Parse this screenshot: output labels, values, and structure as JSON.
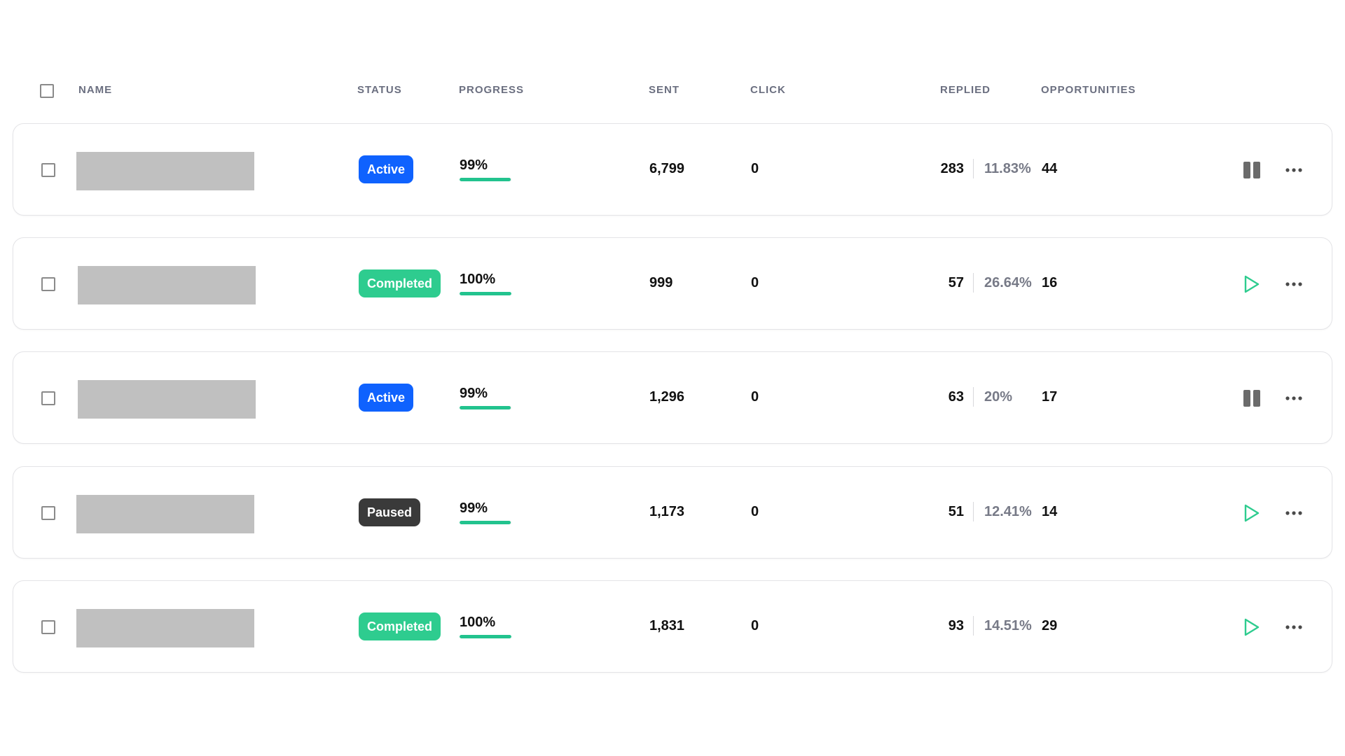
{
  "colors": {
    "active": "#0f62fe",
    "completed": "#2ecc8f",
    "paused": "#3a3a3a",
    "progress_fill": "#22c38e",
    "play_icon": "#2ecc8f",
    "pause_icon": "#6b6b6b"
  },
  "header": {
    "name": "NAME",
    "status": "STATUS",
    "progress": "PROGRESS",
    "sent": "SENT",
    "click": "CLICK",
    "replied": "REPLIED",
    "opportunities": "OPPORTUNITIES"
  },
  "rows": [
    {
      "status": "Active",
      "status_kind": "active",
      "progress": "99%",
      "progress_value": 0.99,
      "sent": "6,799",
      "click": "0",
      "replied": "283",
      "reply_rate": "11.83%",
      "opportunities": "44",
      "action": "pause-icon"
    },
    {
      "status": "Completed",
      "status_kind": "completed",
      "progress": "100%",
      "progress_value": 1.0,
      "sent": "999",
      "click": "0",
      "replied": "57",
      "reply_rate": "26.64%",
      "opportunities": "16",
      "action": "play-icon"
    },
    {
      "status": "Active",
      "status_kind": "active",
      "progress": "99%",
      "progress_value": 0.99,
      "sent": "1,296",
      "click": "0",
      "replied": "63",
      "reply_rate": "20%",
      "opportunities": "17",
      "action": "pause-icon"
    },
    {
      "status": "Paused",
      "status_kind": "paused",
      "progress": "99%",
      "progress_value": 0.99,
      "sent": "1,173",
      "click": "0",
      "replied": "51",
      "reply_rate": "12.41%",
      "opportunities": "14",
      "action": "play-icon"
    },
    {
      "status": "Completed",
      "status_kind": "completed",
      "progress": "100%",
      "progress_value": 1.0,
      "sent": "1,831",
      "click": "0",
      "replied": "93",
      "reply_rate": "14.51%",
      "opportunities": "29",
      "action": "play-icon"
    }
  ]
}
